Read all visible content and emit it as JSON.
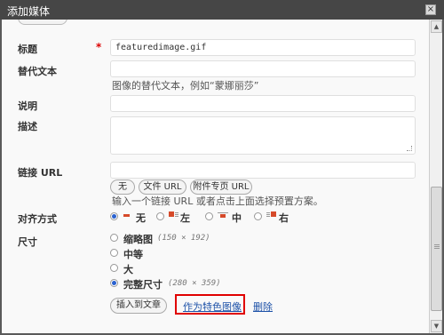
{
  "window": {
    "title": "添加媒体",
    "close": "×"
  },
  "fields": {
    "title_label": "标题",
    "required_mark": "*",
    "title_value": "featuredimage.gif",
    "alt_label": "替代文本",
    "alt_help": "图像的替代文本，例如“蒙娜丽莎”",
    "caption_label": "说明",
    "desc_label": "描述",
    "link_label": "链接 URL",
    "link_buttons": [
      "无",
      "文件 URL",
      "附件专页 URL"
    ],
    "link_help": "输入一个链接 URL 或者点击上面选择预置方案。",
    "align_label": "对齐方式",
    "align_options": [
      "无",
      "左",
      "中",
      "右"
    ],
    "align_selected": "无",
    "size_label": "尺寸",
    "sizes": [
      {
        "name": "缩略图",
        "dims": "(150 × 192)",
        "selected": false
      },
      {
        "name": "中等",
        "dims": "",
        "selected": false
      },
      {
        "name": "大",
        "dims": "",
        "selected": false
      },
      {
        "name": "完整尺寸",
        "dims": "(280 × 359)",
        "selected": true
      }
    ]
  },
  "actions": {
    "insert": "插入到文章",
    "featured": "作为特色图像",
    "delete": "删除"
  },
  "colors": {
    "highlight": "#e00000",
    "link": "#1e52a8",
    "align_icon": "#d64a2a"
  }
}
